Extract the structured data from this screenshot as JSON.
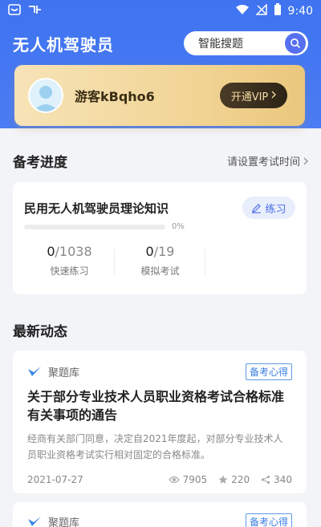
{
  "status_bar": {
    "time": "9:40"
  },
  "header": {
    "title": "无人机驾驶员",
    "search_label": "智能搜题"
  },
  "user": {
    "name": "游客kBqho6",
    "vip_label": "开通VIP"
  },
  "progress_section": {
    "title": "备考进度",
    "link_label": "请设置考试时间"
  },
  "progress_card": {
    "subject": "民用无人机驾驶员理论知识",
    "practice_label": "练习",
    "percent_text": "0%",
    "percent_value": 0,
    "stats": [
      {
        "done": "0",
        "total": "1038",
        "label": "快速练习"
      },
      {
        "done": "0",
        "total": "19",
        "label": "模拟考试"
      }
    ]
  },
  "news_section": {
    "title": "最新动态"
  },
  "news": [
    {
      "source": "聚题库",
      "tag": "备考心得",
      "title": "关于部分专业技术人员职业资格考试合格标准有关事项的通告",
      "desc": "经商有关部门同意，决定自2021年度起，对部分专业技术人员职业资格考试实行相对固定的合格标准。",
      "date": "2021-07-27",
      "views": "7905",
      "stars": "220",
      "shares": "340"
    },
    {
      "source": "聚题库",
      "tag": "备考心得"
    }
  ],
  "colors": {
    "primary": "#4a7cf3",
    "gold": "#f2d596",
    "tag": "#3d7ee0"
  }
}
